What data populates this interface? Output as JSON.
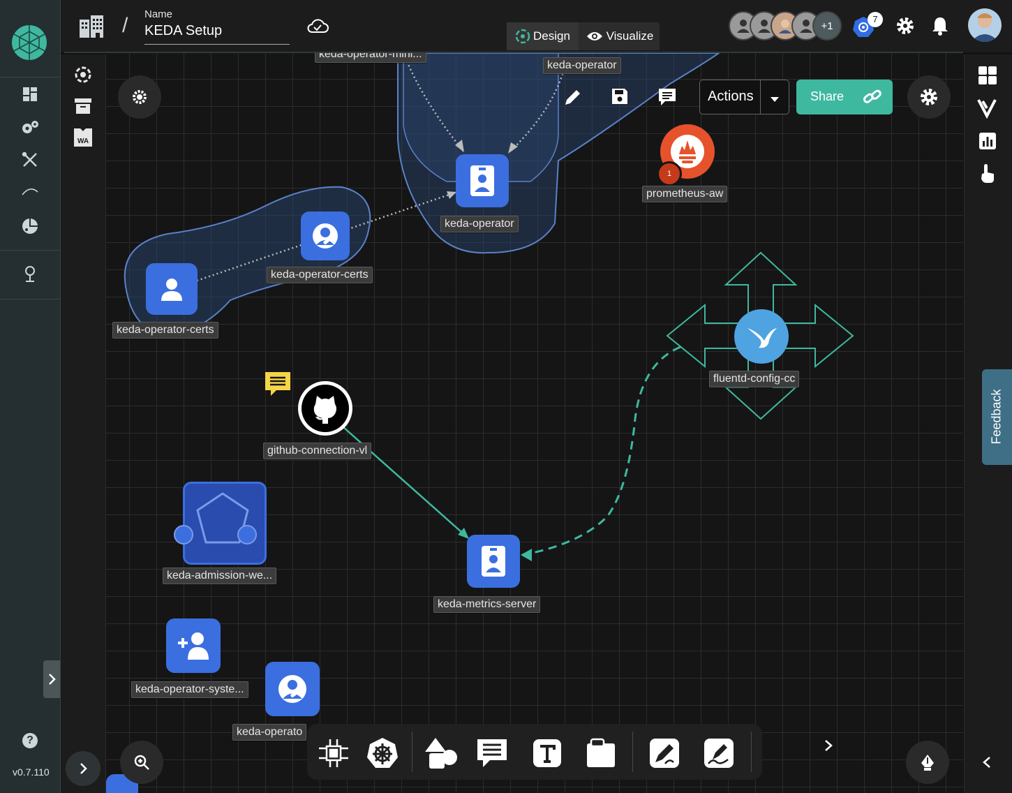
{
  "header": {
    "name_label": "Name",
    "design_name": "KEDA Setup",
    "tabs": [
      {
        "label": "Design",
        "active": true
      },
      {
        "label": "Visualize",
        "active": false
      }
    ],
    "extra_collaborators": "+1",
    "k8s_badge_count": "7"
  },
  "toolbar": {
    "actions_label": "Actions",
    "share_label": "Share"
  },
  "sidebar2": {
    "wa_label": "WA"
  },
  "nodes": {
    "operator_mini_top": "keda-operator-mini...",
    "operator_top": "keda-operator",
    "operator_main": "keda-operator",
    "prometheus": "prometheus-aw",
    "prometheus_badge": "1",
    "certs_right": "keda-operator-certs",
    "certs_left": "keda-operator-certs",
    "fluentd": "fluentd-config-cc",
    "github": "github-connection-vl",
    "admission": "keda-admission-we...",
    "metrics_server": "keda-metrics-server",
    "operator_system": "keda-operator-syste...",
    "operator_bottom": "keda-operato"
  },
  "feedback": {
    "label": "Feedback"
  },
  "footer": {
    "version": "v0.7.110"
  },
  "colors": {
    "accent_teal": "#3fb8a0",
    "share_button": "#3fb8a0",
    "node_blue": "#3b6fe0",
    "group_outline": "#5a82c8",
    "prometheus_orange": "#e6522c",
    "fluentd_blue": "#4fa3e0",
    "note_yellow": "#f5d547",
    "nav_background": "#252e31"
  },
  "icons": [
    "meshery-logo-icon",
    "dashboard-icon",
    "configuration-icon",
    "tools-icon",
    "performance-icon",
    "extensions-icon",
    "location-icon",
    "help-icon",
    "building-icon",
    "cloud-check-icon",
    "design-icon",
    "eye-icon",
    "kubernetes-icon",
    "settings-icon",
    "bell-icon",
    "kanvas-icon",
    "catalog-icon",
    "wasm-icon",
    "pencil-icon",
    "save-icon",
    "comment-icon",
    "link-icon",
    "grid-layout-icon",
    "y-icon",
    "chart-icon",
    "hand-pointer-icon",
    "zoom-icon",
    "shapes-icon",
    "text-icon",
    "pen-icon",
    "signature-icon"
  ]
}
